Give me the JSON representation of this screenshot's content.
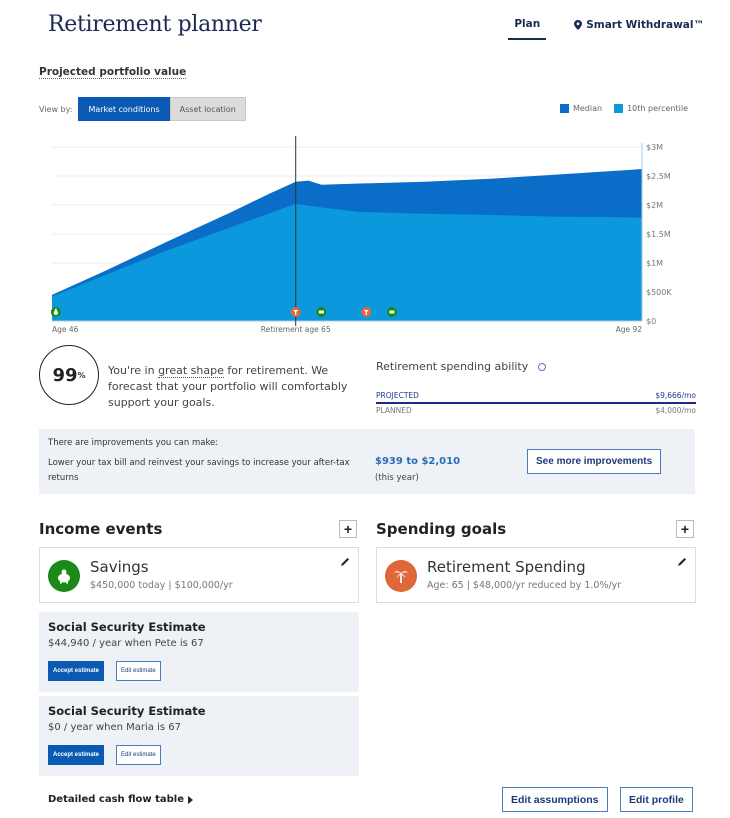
{
  "header": {
    "title": "Retirement planner",
    "tabs": [
      {
        "label": "Plan",
        "active": true
      },
      {
        "label": "Smart Withdrawal™",
        "icon": "map-pin-icon",
        "active": false
      }
    ]
  },
  "portfolio": {
    "section_label": "Projected portfolio value",
    "view_by_label": "View by:",
    "view_options": [
      {
        "label": "Market conditions",
        "active": true
      },
      {
        "label": "Asset location",
        "active": false
      }
    ],
    "legend": [
      {
        "label": "Median",
        "color": "#0a6dc7"
      },
      {
        "label": "10th percentile",
        "color": "#0b98dc"
      }
    ]
  },
  "chart_data": {
    "type": "area",
    "title": "Projected portfolio value",
    "xlabel": "Age",
    "ylabel": "",
    "x_range": [
      46,
      92
    ],
    "ylim": [
      0,
      3000000
    ],
    "y_ticks": [
      0,
      500000,
      1000000,
      1500000,
      2000000,
      2500000,
      3000000
    ],
    "y_tick_labels": [
      "$0",
      "$500K",
      "$1M",
      "$1.5M",
      "$2M",
      "$2.5M",
      "$3M"
    ],
    "x_tick_labels": [
      {
        "age": 46,
        "label": "Age 46"
      },
      {
        "age": 65,
        "label": "Retirement age 65"
      },
      {
        "age": 92,
        "label": "Age 92"
      }
    ],
    "retirement_marker_age": 65,
    "grid": true,
    "legend_position": "top-right",
    "series": [
      {
        "name": "Median",
        "color": "#0a6dc7",
        "x": [
          46,
          50,
          55,
          60,
          63,
          65,
          66,
          67,
          70,
          75,
          80,
          85,
          90,
          92
        ],
        "values": [
          450000,
          850000,
          1370000,
          1880000,
          2200000,
          2400000,
          2420000,
          2350000,
          2370000,
          2400000,
          2450000,
          2520000,
          2590000,
          2620000
        ]
      },
      {
        "name": "10th percentile",
        "color": "#0b98dc",
        "x": [
          46,
          50,
          55,
          60,
          63,
          65,
          67,
          70,
          75,
          80,
          85,
          90,
          92
        ],
        "values": [
          420000,
          780000,
          1220000,
          1620000,
          1860000,
          2020000,
          1960000,
          1880000,
          1850000,
          1830000,
          1800000,
          1790000,
          1780000
        ]
      }
    ],
    "event_markers": [
      {
        "age": 46.3,
        "type": "savings",
        "icon": "piggy-bank-icon",
        "color": "#1a8a1a"
      },
      {
        "age": 65,
        "type": "spending",
        "icon": "palm-tree-icon",
        "color": "#e0673a"
      },
      {
        "age": 67,
        "type": "income",
        "icon": "cash-icon",
        "color": "#1a8a1a"
      },
      {
        "age": 70.5,
        "type": "spending",
        "icon": "palm-tree-icon",
        "color": "#e0673a"
      },
      {
        "age": 72.5,
        "type": "income",
        "icon": "cash-icon",
        "color": "#1a8a1a"
      }
    ]
  },
  "score": {
    "value": "99",
    "unit": "%",
    "text_before": "You're in ",
    "text_link": "great shape",
    "text_after": " for retirement. We forecast that your portfolio will comfortably support your goals."
  },
  "spending_ability": {
    "title": "Retirement spending ability",
    "rows": [
      {
        "label": "PROJECTED",
        "value": "$9,666/mo"
      },
      {
        "label": "PLANNED",
        "value": "$4,000/mo"
      }
    ]
  },
  "improvements": {
    "title": "There are improvements you can make:",
    "description": "Lower your tax bill and reinvest your savings to increase your after-tax returns",
    "range": "$939 to $2,010",
    "period": "(this year)",
    "button": "See more improvements"
  },
  "income_events": {
    "heading": "Income events",
    "add_label": "+",
    "card": {
      "title": "Savings",
      "subtitle": "$450,000 today | $100,000/yr"
    },
    "social_security": [
      {
        "title": "Social Security Estimate",
        "subtitle": "$44,940 / year when Pete is 67",
        "accept": "Accept estimate",
        "edit": "Edit estimate"
      },
      {
        "title": "Social Security Estimate",
        "subtitle": "$0 / year when Maria is 67",
        "accept": "Accept estimate",
        "edit": "Edit estimate"
      }
    ]
  },
  "spending_goals": {
    "heading": "Spending goals",
    "add_label": "+",
    "card": {
      "title": "Retirement Spending",
      "subtitle": "Age: 65 | $48,000/yr reduced by 1.0%/yr"
    }
  },
  "footer": {
    "cashflow_link": "Detailed cash flow table",
    "edit_assumptions": "Edit assumptions",
    "edit_profile": "Edit profile"
  }
}
